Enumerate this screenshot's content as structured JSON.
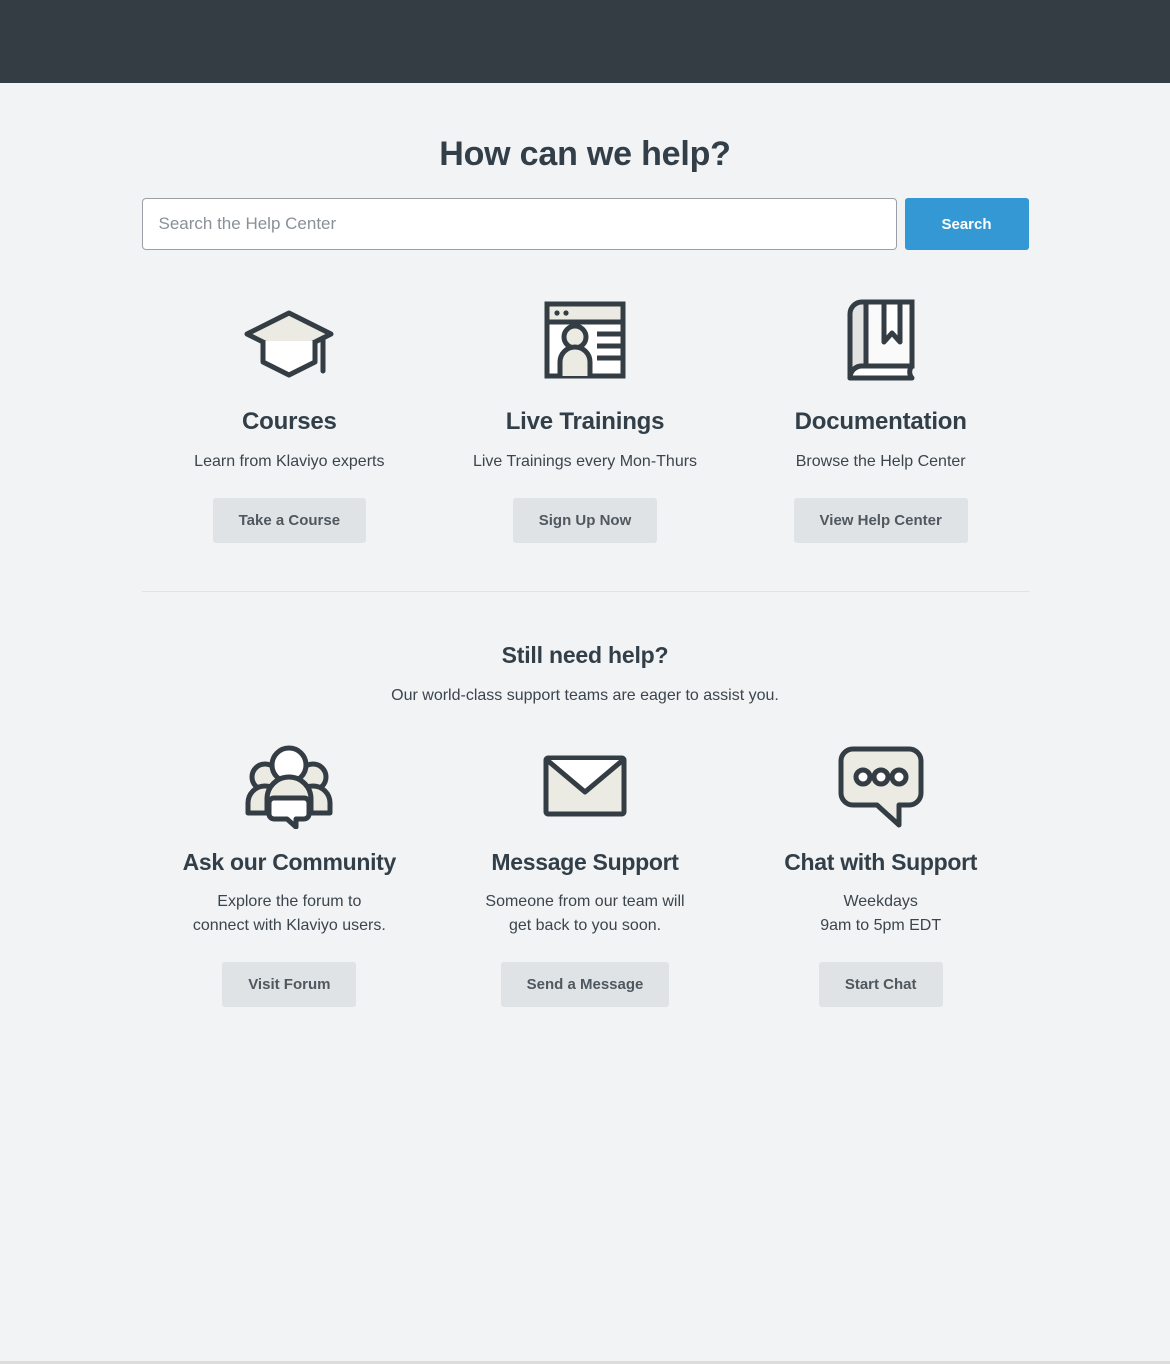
{
  "header": {
    "bar_color": "#343c44"
  },
  "hero": {
    "title": "How can we help?"
  },
  "search": {
    "placeholder": "Search the Help Center",
    "value": "",
    "button_label": "Search",
    "button_color": "#3498d4"
  },
  "resources": {
    "cards": [
      {
        "icon": "graduation-cap-icon",
        "title": "Courses",
        "desc": "Learn from Klaviyo experts",
        "button_label": "Take a Course"
      },
      {
        "icon": "webinar-window-icon",
        "title": "Live Trainings",
        "desc": "Live Trainings every Mon-Thurs",
        "button_label": "Sign Up Now"
      },
      {
        "icon": "book-icon",
        "title": "Documentation",
        "desc": "Browse the Help Center",
        "button_label": "View Help Center"
      }
    ]
  },
  "support": {
    "title": "Still need help?",
    "subtitle": "Our world-class support teams are eager to assist you.",
    "cards": [
      {
        "icon": "community-group-icon",
        "title": "Ask our Community",
        "desc_line1": "Explore the forum to",
        "desc_line2": "connect with Klaviyo users.",
        "button_label": "Visit Forum"
      },
      {
        "icon": "envelope-icon",
        "title": "Message Support",
        "desc_line1": "Someone from our team will",
        "desc_line2": "get back to you soon.",
        "button_label": "Send a Message"
      },
      {
        "icon": "chat-bubble-icon",
        "title": "Chat with Support",
        "desc_line1": "Weekdays",
        "desc_line2": "9am to 5pm EDT",
        "button_label": "Start Chat"
      }
    ]
  },
  "theme": {
    "page_background": "#f1f3f5",
    "text_color": "#333f48",
    "button_background": "#dfe3e6",
    "icon_stroke": "#343c44",
    "icon_fill": "#ebebe4"
  }
}
